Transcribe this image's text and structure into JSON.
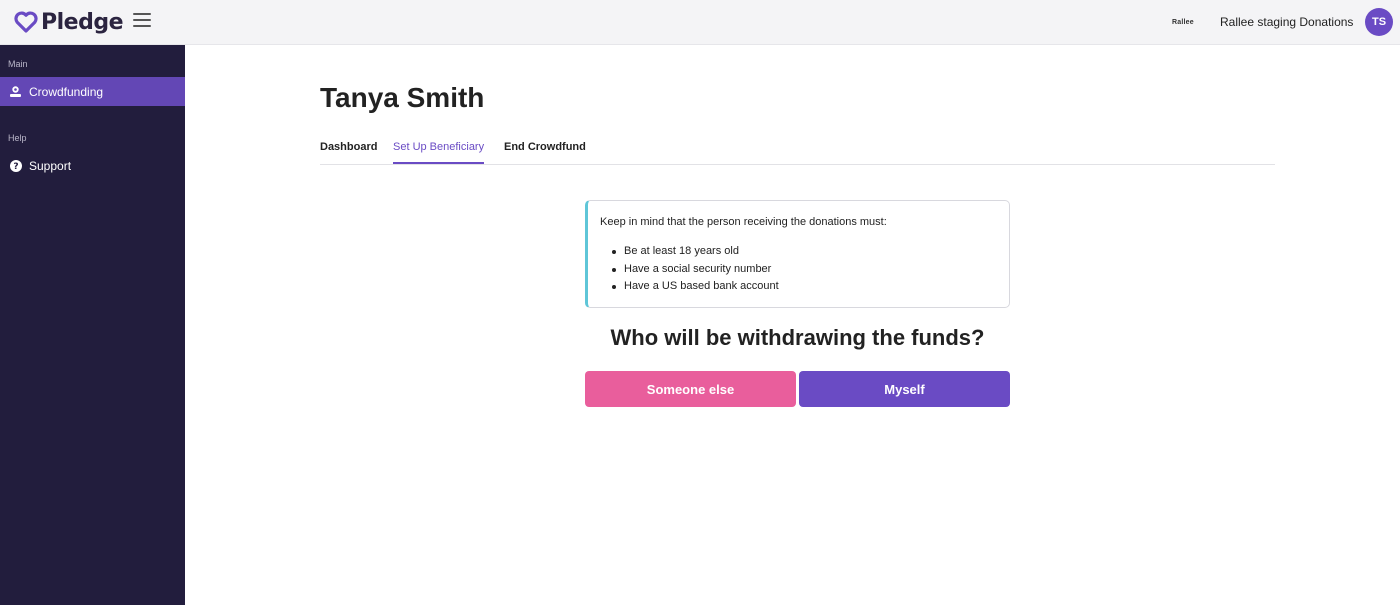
{
  "app": {
    "brand": "Pledge",
    "org_logo_text": "Rallee",
    "org_name": "Rallee staging Donations",
    "avatar_initials": "TS",
    "accent_color": "#6a4bc4",
    "sidebar_color": "#221d3d"
  },
  "sidebar": {
    "sections": [
      {
        "title": "Main",
        "items": [
          {
            "label": "Crowdfunding",
            "icon": "donation-hand-icon",
            "active": true
          }
        ]
      },
      {
        "title": "Help",
        "items": [
          {
            "label": "Support",
            "icon": "question-circle-icon",
            "active": false
          }
        ]
      }
    ]
  },
  "page": {
    "title": "Tanya Smith",
    "tabs": [
      {
        "label": "Dashboard",
        "active": false
      },
      {
        "label": "Set Up Beneficiary",
        "active": true
      },
      {
        "label": "End Crowdfund",
        "active": false
      }
    ]
  },
  "notice": {
    "intro": "Keep in mind that the person receiving the donations must:",
    "requirements": [
      "Be at least 18 years old",
      "Have a social security number",
      "Have a US based bank account"
    ]
  },
  "question": "Who will be withdrawing the funds?",
  "buttons": {
    "someone_else": "Someone else",
    "myself": "Myself",
    "someone_else_color": "#e95e9c",
    "myself_color": "#6a4bc4"
  }
}
